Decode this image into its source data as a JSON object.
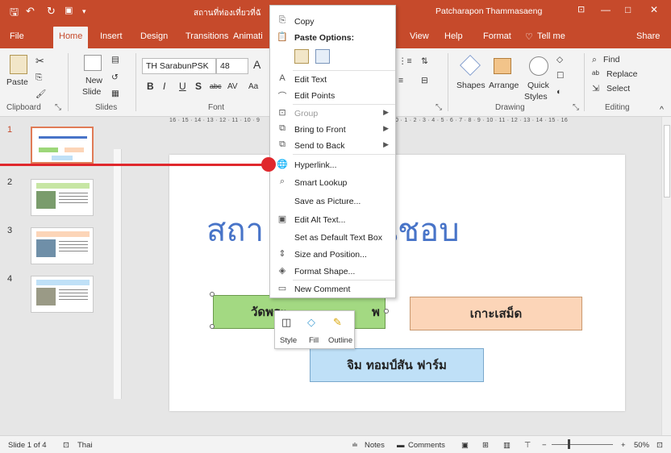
{
  "titlebar": {
    "doc_title": "สถานที่ท่องเที่ยวที่ฉั",
    "user": "Patcharapon Thammasaeng",
    "minimize": "—",
    "restore": "□",
    "close": "✕"
  },
  "tabs": [
    {
      "label": "File"
    },
    {
      "label": "Home"
    },
    {
      "label": "Insert"
    },
    {
      "label": "Design"
    },
    {
      "label": "Transitions"
    },
    {
      "label": "Animati"
    },
    {
      "label": "View"
    },
    {
      "label": "Help"
    },
    {
      "label": "Format"
    },
    {
      "label": "Tell me"
    },
    {
      "label": "Share"
    }
  ],
  "ribbon": {
    "paste": "Paste",
    "new_slide": "New",
    "new_slide2": "Slide",
    "font_name": "TH SarabunPSK",
    "font_size": "48",
    "bold": "B",
    "italic": "I",
    "underline": "U",
    "shadow": "S",
    "strike": "abc",
    "spacing": "AV",
    "case": "Aa",
    "grow": "A",
    "shapes": "Shapes",
    "arrange": "Arrange",
    "quick": "Quick",
    "styles": "Styles",
    "find": "Find",
    "replace": "Replace",
    "select": "Select",
    "groups": {
      "clipboard": "Clipboard",
      "slides": "Slides",
      "font": "Font",
      "drawing": "Drawing",
      "editing": "Editing"
    }
  },
  "ruler": {
    "h": "16 · 15 · 14 · 13 · 12 · 11 · 10 · 9",
    "h2": "0 · 1 · 2 · 3 · 4 · 5 · 6 · 7 · 8 · 9 · 10 · 11 · 12 · 13 · 14 · 15 · 16"
  },
  "thumbnails": [
    {
      "num": "1"
    },
    {
      "num": "2"
    },
    {
      "num": "3"
    },
    {
      "num": "4"
    }
  ],
  "slide": {
    "title": "สถา          ที่ยวที่ฉันชอบ",
    "btn1": "วัดพระ",
    "btn1b": "พ",
    "btn2": "เกาะเสม็ด",
    "btn3": "จิม ทอมป์สัน ฟาร์ม"
  },
  "menu": {
    "copy": "Copy",
    "paste_options": "Paste Options:",
    "edit_text": "Edit Text",
    "edit_points": "Edit Points",
    "group": "Group",
    "bring_front": "Bring to Front",
    "send_back": "Send to Back",
    "hyperlink": "Hyperlink...",
    "smart_lookup": "Smart Lookup",
    "save_picture": "Save as Picture...",
    "edit_alt": "Edit Alt Text...",
    "default_box": "Set as Default Text Box",
    "size_pos": "Size and Position...",
    "format_shape": "Format Shape...",
    "new_comment": "New Comment"
  },
  "mini": {
    "style": "Style",
    "fill": "Fill",
    "outline": "Outline"
  },
  "status": {
    "slide": "Slide 1 of 4",
    "lang": "Thai",
    "notes": "Notes",
    "comments": "Comments",
    "zoom": "50%"
  },
  "colors": {
    "accent": "#c64a2b",
    "callout": "#e0282d",
    "title": "#4874c8"
  }
}
